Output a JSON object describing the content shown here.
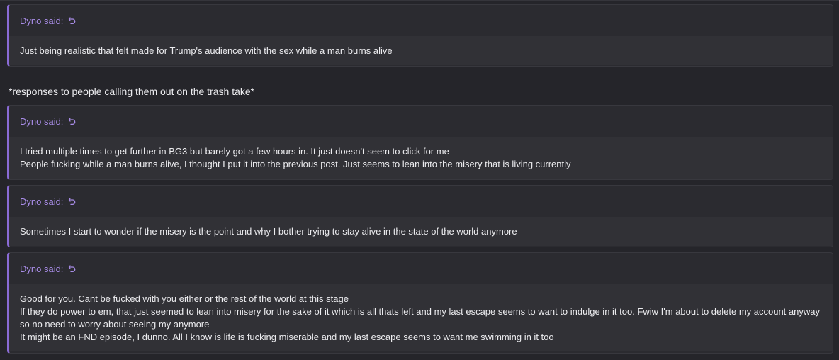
{
  "quotes": [
    {
      "author_label": "Dyno said:",
      "lines": [
        "Just being realistic that felt made for Trump's audience with the sex while a man burns alive"
      ]
    },
    {
      "author_label": "Dyno said:",
      "lines": [
        "I tried multiple times to get further in BG3 but barely got a few hours in. It just doesn't seem to click for me",
        "People fucking while a man burns alive, I thought I put it into the previous post. Just seems to lean into the misery that is living currently"
      ]
    },
    {
      "author_label": "Dyno said:",
      "lines": [
        "Sometimes I start to wonder if the misery is the point and why I bother trying to stay alive in the state of the world anymore"
      ]
    },
    {
      "author_label": "Dyno said:",
      "lines": [
        "Good for you. Cant be fucked with you either or the rest of the world at this stage",
        "If they do power to em, that just seemed to lean into misery for the sake of it which is all thats left and my last escape seems to want to indulge in it too. Fwiw I'm about to delete my account anyway",
        "so no need to worry about seeing my anymore",
        "It might be an FND episode, I dunno. All I know is life is fucking miserable and my last escape seems to want me swimming in it too"
      ]
    }
  ],
  "between_text": "*responses to people calling them out on the trash take*",
  "icons": {
    "quote_link": "jump-to-quote-icon"
  },
  "colors": {
    "accent": "#8a6bd6",
    "author": "#a98de8"
  }
}
